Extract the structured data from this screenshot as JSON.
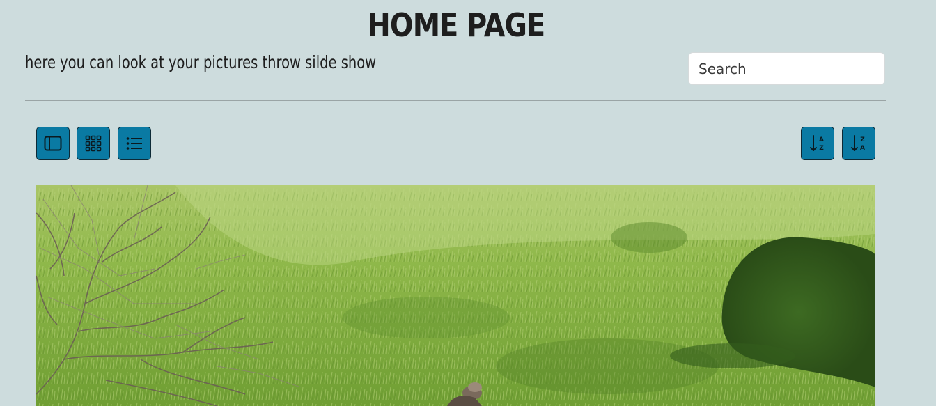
{
  "header": {
    "title": "HOME PAGE",
    "subtitle": "here you can look at your pictures throw silde show"
  },
  "search": {
    "placeholder": "Search"
  },
  "toolbar": {
    "view_buttons": [
      {
        "icon": "sidebar-layout-icon"
      },
      {
        "icon": "grid-icon"
      },
      {
        "icon": "list-icon"
      }
    ],
    "sort_buttons": [
      {
        "icon": "sort-alpha-down-icon"
      },
      {
        "icon": "sort-alpha-up-icon"
      }
    ],
    "sort_glyphs": {
      "az_top": "A",
      "az_bottom": "Z",
      "za_top": "Z",
      "za_bottom": "A"
    }
  },
  "colors": {
    "background": "#cddcdd",
    "button": "#0a7aa3",
    "button_border": "#0d2a36"
  },
  "gallery": {
    "current_image": "grassland-hillside-with-bird-photo"
  }
}
